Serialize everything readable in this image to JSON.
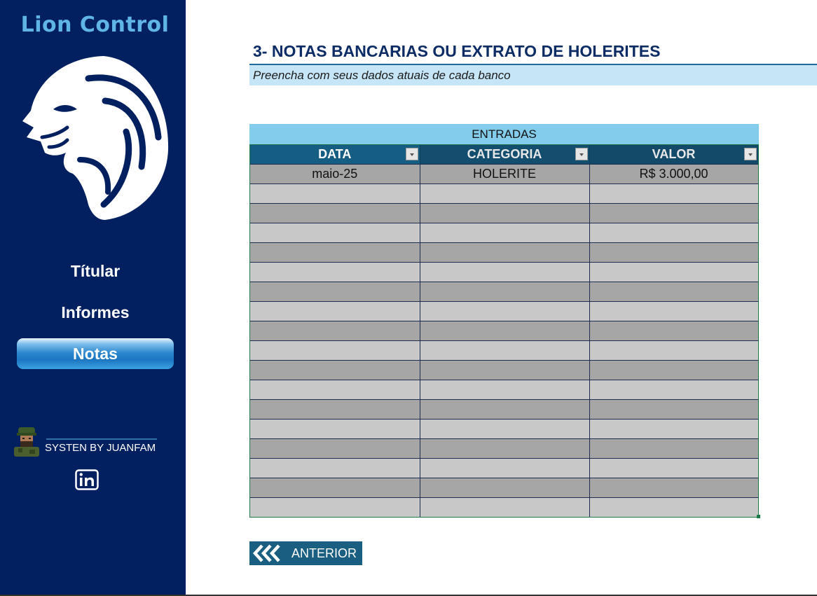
{
  "sidebar": {
    "brand": "Lion Control",
    "logo_icon": "lion-head-logo",
    "items": [
      {
        "label": "Títular",
        "active": false
      },
      {
        "label": "Informes",
        "active": false
      },
      {
        "label": "Notas",
        "active": true
      }
    ],
    "credit": "SYSTEN BY JUANFAM",
    "linkedin_icon": "linkedin-icon"
  },
  "main": {
    "title": "3- NOTAS BANCARIAS OU EXTRATO DE HOLERITES",
    "subtitle": "Preencha  com seus dados atuais de cada banco",
    "table": {
      "caption": "ENTRADAS",
      "columns": [
        "DATA",
        "CATEGORIA",
        "VALOR"
      ],
      "rows": [
        [
          "maio-25",
          "HOLERITE",
          "R$ 3.000,00"
        ],
        [
          "",
          "",
          ""
        ],
        [
          "",
          "",
          ""
        ],
        [
          "",
          "",
          ""
        ],
        [
          "",
          "",
          ""
        ],
        [
          "",
          "",
          ""
        ],
        [
          "",
          "",
          ""
        ],
        [
          "",
          "",
          ""
        ],
        [
          "",
          "",
          ""
        ],
        [
          "",
          "",
          ""
        ],
        [
          "",
          "",
          ""
        ],
        [
          "",
          "",
          ""
        ],
        [
          "",
          "",
          ""
        ],
        [
          "",
          "",
          ""
        ],
        [
          "",
          "",
          ""
        ],
        [
          "",
          "",
          ""
        ],
        [
          "",
          "",
          ""
        ],
        [
          "",
          "",
          ""
        ]
      ]
    },
    "back_button": "ANTERIOR"
  },
  "colors": {
    "sidebar_bg": "#022060",
    "brand": "#5fb5e6",
    "header_bg": "#165d84",
    "row_dark": "#a6a6a6",
    "row_light": "#c8c8c8",
    "band": "#84ccec"
  }
}
